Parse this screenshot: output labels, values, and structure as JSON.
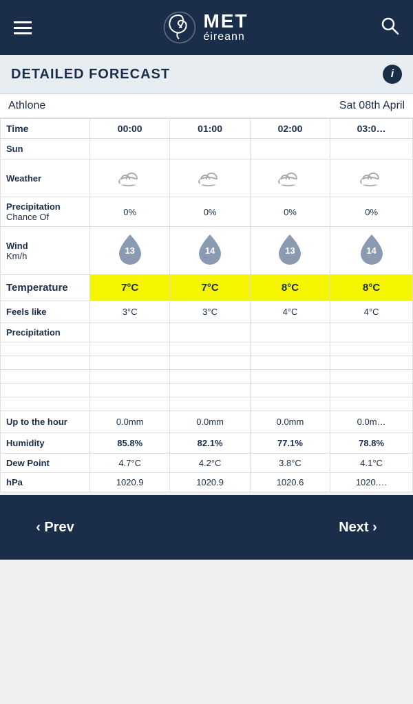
{
  "header": {
    "menu_label": "Menu",
    "logo_met": "MET",
    "logo_eireann": "éireann",
    "search_label": "Search"
  },
  "section": {
    "title": "DETAILED FORECAST",
    "info_label": "i"
  },
  "location": {
    "name": "Athlone",
    "date": "Sat 08th April"
  },
  "table": {
    "row_time": "Time",
    "row_sun": "Sun",
    "row_weather": "Weather",
    "row_precip_label": "Precipitation",
    "row_precip_sub": "Chance Of",
    "row_wind_label": "Wind",
    "row_wind_sub": "Km/h",
    "row_temp_label": "Temperature",
    "row_feels_label": "Feels like",
    "row_precip2_label": "Precipitation",
    "row_uphour_label": "Up to the hour",
    "row_humidity_label": "Humidity",
    "row_dew_label": "Dew Point",
    "row_hpa_label": "hPa",
    "columns": [
      "00:00",
      "01:00",
      "02:00",
      "03:0…"
    ],
    "precip_pct": [
      "0%",
      "0%",
      "0%",
      "0%"
    ],
    "wind_nums": [
      13,
      14,
      13,
      14
    ],
    "temp": [
      "7°C",
      "7°C",
      "8°C",
      "8°C"
    ],
    "feels": [
      "3°C",
      "3°C",
      "4°C",
      "4°C"
    ],
    "uphour": [
      "0.0mm",
      "0.0mm",
      "0.0mm",
      "0.0m…"
    ],
    "humidity": [
      "85.8%",
      "82.1%",
      "77.1%",
      "78.8%"
    ],
    "dew": [
      "4.7°C",
      "4.2°C",
      "3.8°C",
      "4.1°C"
    ],
    "hpa": [
      "1020.9",
      "1020.9",
      "1020.6",
      "1020.…"
    ]
  },
  "footer": {
    "prev_label": "‹ Prev",
    "next_label": "Next ›"
  }
}
